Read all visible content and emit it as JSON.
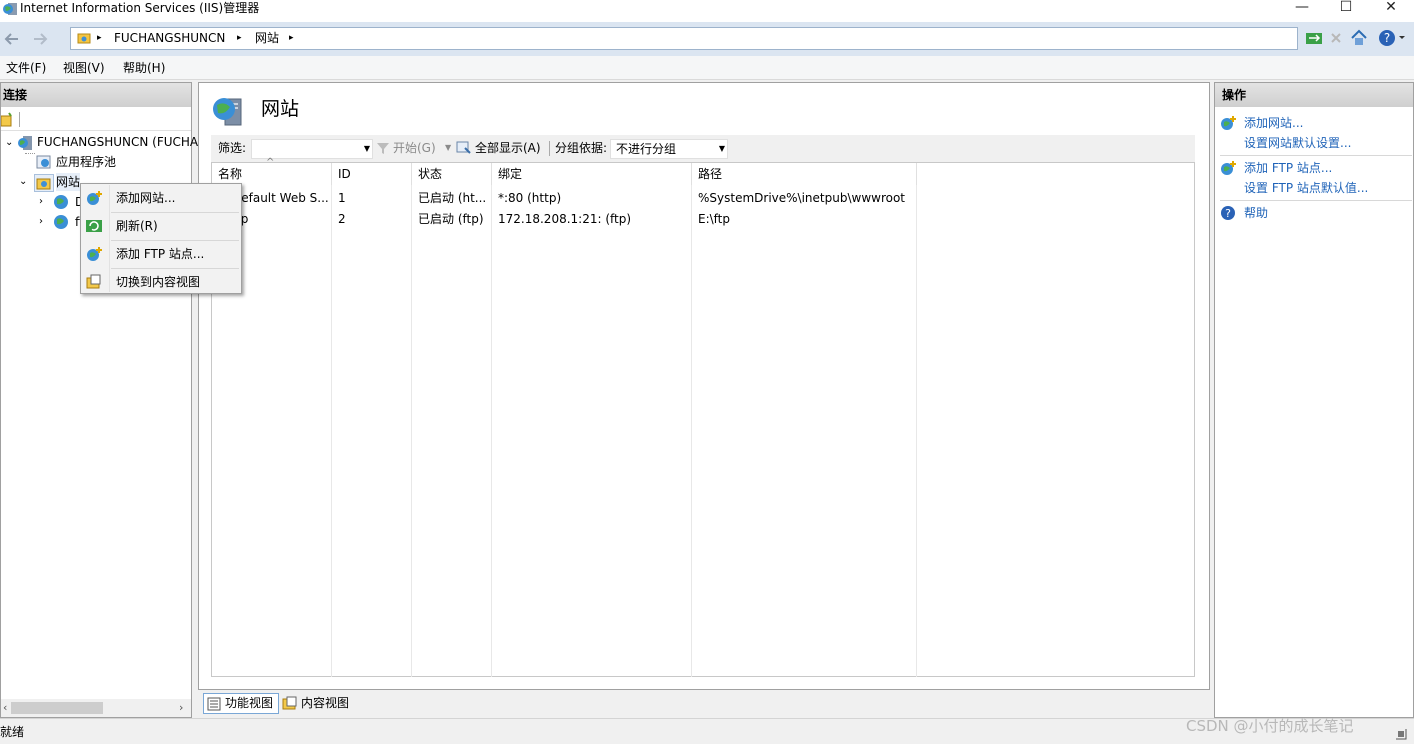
{
  "window": {
    "title": "Internet Information Services (IIS)管理器",
    "minimize_glyph": "—",
    "maximize_glyph": "☐",
    "close_glyph": "✕"
  },
  "address": {
    "segments": [
      "FUCHANGSHUNCN",
      "网站"
    ],
    "separator": "▸"
  },
  "menu": {
    "items": [
      "文件(F)",
      "视图(V)",
      "帮助(H)"
    ]
  },
  "connections": {
    "header": "连接",
    "tree": {
      "server": "FUCHANGSHUNCN (FUCHA",
      "app_pools": "应用程序池",
      "sites": "网站",
      "site1_partial": "D",
      "site2_partial": "ft"
    }
  },
  "main": {
    "title": "网站",
    "filter": {
      "label": "筛选:",
      "start": "开始(G)",
      "show_all": "全部显示(A)",
      "group_by_label": "分组依据:",
      "group_by_value": "不进行分组"
    },
    "columns": [
      "名称",
      "ID",
      "状态",
      "绑定",
      "路径"
    ],
    "rows": [
      {
        "name": "Default Web S...",
        "id": "1",
        "status": "已启动 (ht...",
        "binding": "*:80 (http)",
        "path": "%SystemDrive%\\inetpub\\wwwroot"
      },
      {
        "name": "ftp",
        "id": "2",
        "status": "已启动 (ftp)",
        "binding": "172.18.208.1:21: (ftp)",
        "path": "E:\\ftp"
      }
    ],
    "views": {
      "features": "功能视图",
      "content": "内容视图"
    }
  },
  "actions": {
    "header": "操作",
    "add_site": "添加网站...",
    "site_defaults": "设置网站默认设置...",
    "add_ftp": "添加 FTP 站点...",
    "ftp_defaults": "设置 FTP 站点默认值...",
    "help": "帮助"
  },
  "context_menu": {
    "add_site": "添加网站...",
    "refresh": "刷新(R)",
    "add_ftp": "添加 FTP 站点...",
    "switch_content": "切换到内容视图"
  },
  "status": {
    "text": "就绪"
  },
  "watermark": "CSDN @小付的成长笔记",
  "colors": {
    "link": "#1f63b8",
    "address_bar": "#dbe5f1",
    "panel_header": "#d6d6d6"
  }
}
